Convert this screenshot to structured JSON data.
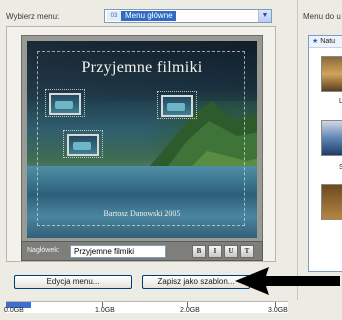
{
  "menu_selector": {
    "label": "Wybierz menu:",
    "badge": "03",
    "selected": "Menu główne"
  },
  "right_panel": {
    "header": "Menu do u",
    "tab_label": "Natu",
    "items": [
      {
        "label": "L"
      },
      {
        "label": "Sh"
      }
    ]
  },
  "preview": {
    "title": "Przyjemne filmiki",
    "author": "Bartosz Danowski 2005"
  },
  "heading": {
    "label": "Nagłówek:",
    "value": "Przyjemne filmiki",
    "format_buttons": [
      "B",
      "I",
      "U",
      "T"
    ]
  },
  "buttons": {
    "edit_menu": "Edycja menu...",
    "save_template": "Zapisz jako szablon..."
  },
  "capacity": {
    "ticks": [
      "0.0GB",
      "1.0GB",
      "2.0GB",
      "3.0GB"
    ],
    "used_fraction": 0.09,
    "fill_color": "#3d6fd2"
  },
  "colors": {
    "accent": "#316ac5",
    "arrow": "#000000"
  }
}
